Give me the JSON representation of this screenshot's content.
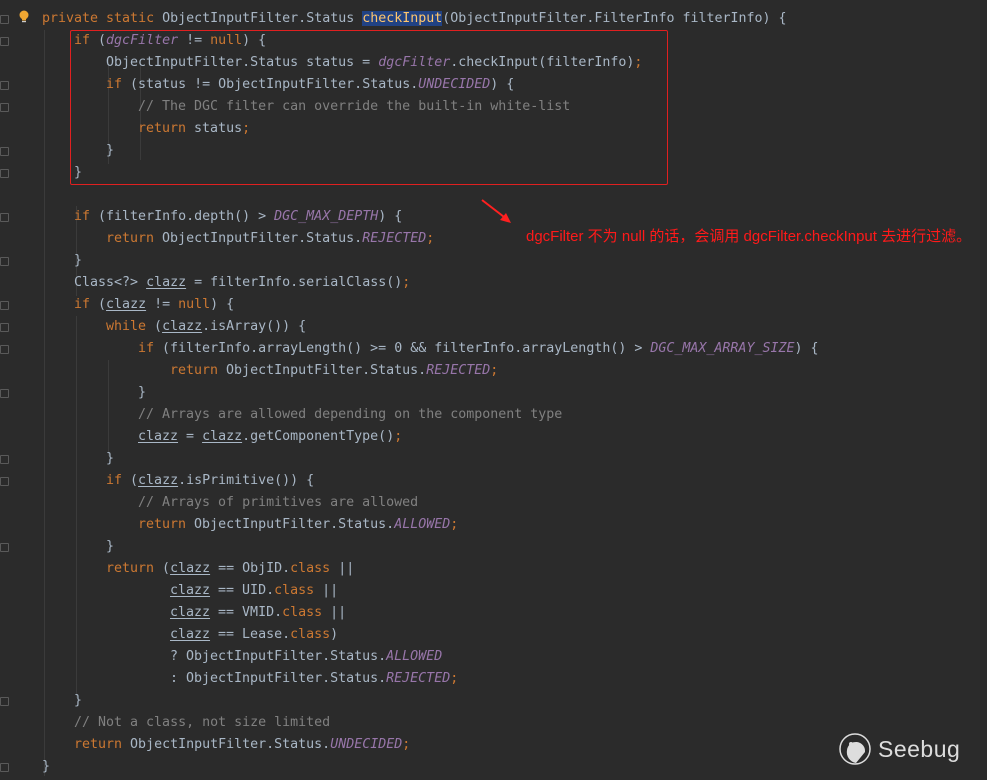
{
  "editor": {
    "lines": [
      [
        0,
        [
          [
            "kw",
            "private static "
          ],
          [
            "p",
            "ObjectInputFilter.Status "
          ],
          [
            "md",
            "checkInput"
          ],
          [
            "p",
            "(ObjectInputFilter.FilterInfo filterInfo) {"
          ]
        ]
      ],
      [
        1,
        [
          [
            "kw",
            "if "
          ],
          [
            "p",
            "("
          ],
          [
            "fld",
            "dgcFilter"
          ],
          [
            "p",
            " != "
          ],
          [
            "kw",
            "null"
          ],
          [
            "p",
            ") {"
          ]
        ]
      ],
      [
        2,
        [
          [
            "p",
            "ObjectInputFilter.Status status = "
          ],
          [
            "fld",
            "dgcFilter"
          ],
          [
            "p",
            ".checkInput(filterInfo)"
          ],
          [
            "kw",
            ";"
          ]
        ]
      ],
      [
        2,
        [
          [
            "kw",
            "if "
          ],
          [
            "p",
            "(status != ObjectInputFilter.Status."
          ],
          [
            "fld",
            "UNDECIDED"
          ],
          [
            "p",
            ") {"
          ]
        ]
      ],
      [
        3,
        [
          [
            "cm",
            "// The DGC filter can override the built-in white-list"
          ]
        ]
      ],
      [
        3,
        [
          [
            "kw",
            "return "
          ],
          [
            "p",
            "status"
          ],
          [
            "kw",
            ";"
          ]
        ]
      ],
      [
        2,
        [
          [
            "p",
            "}"
          ]
        ]
      ],
      [
        1,
        [
          [
            "p",
            "}"
          ]
        ]
      ],
      [
        0,
        []
      ],
      [
        1,
        [
          [
            "kw",
            "if "
          ],
          [
            "p",
            "(filterInfo.depth() > "
          ],
          [
            "fld",
            "DGC_MAX_DEPTH"
          ],
          [
            "p",
            ") {"
          ]
        ]
      ],
      [
        2,
        [
          [
            "kw",
            "return "
          ],
          [
            "p",
            "ObjectInputFilter.Status."
          ],
          [
            "fld",
            "REJECTED"
          ],
          [
            "kw",
            ";"
          ]
        ]
      ],
      [
        1,
        [
          [
            "p",
            "}"
          ]
        ]
      ],
      [
        1,
        [
          [
            "p",
            "Class<?> "
          ],
          [
            "ul",
            "clazz"
          ],
          [
            "p",
            " = filterInfo.serialClass()"
          ],
          [
            "kw",
            ";"
          ]
        ]
      ],
      [
        1,
        [
          [
            "kw",
            "if "
          ],
          [
            "p",
            "("
          ],
          [
            "ul",
            "clazz"
          ],
          [
            "p",
            " != "
          ],
          [
            "kw",
            "null"
          ],
          [
            "p",
            ") {"
          ]
        ]
      ],
      [
        2,
        [
          [
            "kw",
            "while "
          ],
          [
            "p",
            "("
          ],
          [
            "ul",
            "clazz"
          ],
          [
            "p",
            ".isArray()) {"
          ]
        ]
      ],
      [
        3,
        [
          [
            "kw",
            "if "
          ],
          [
            "p",
            "(filterInfo.arrayLength() >= 0 && filterInfo.arrayLength() > "
          ],
          [
            "fld",
            "DGC_MAX_ARRAY_SIZE"
          ],
          [
            "p",
            ") {"
          ]
        ]
      ],
      [
        4,
        [
          [
            "kw",
            "return "
          ],
          [
            "p",
            "ObjectInputFilter.Status."
          ],
          [
            "fld",
            "REJECTED"
          ],
          [
            "kw",
            ";"
          ]
        ]
      ],
      [
        3,
        [
          [
            "p",
            "}"
          ]
        ]
      ],
      [
        3,
        [
          [
            "cm",
            "// Arrays are allowed depending on the component type"
          ]
        ]
      ],
      [
        3,
        [
          [
            "ul",
            "clazz"
          ],
          [
            "p",
            " = "
          ],
          [
            "ul",
            "clazz"
          ],
          [
            "p",
            ".getComponentType()"
          ],
          [
            "kw",
            ";"
          ]
        ]
      ],
      [
        2,
        [
          [
            "p",
            "}"
          ]
        ]
      ],
      [
        2,
        [
          [
            "kw",
            "if "
          ],
          [
            "p",
            "("
          ],
          [
            "ul",
            "clazz"
          ],
          [
            "p",
            ".isPrimitive()) {"
          ]
        ]
      ],
      [
        3,
        [
          [
            "cm",
            "// Arrays of primitives are allowed"
          ]
        ]
      ],
      [
        3,
        [
          [
            "kw",
            "return "
          ],
          [
            "p",
            "ObjectInputFilter.Status."
          ],
          [
            "fld",
            "ALLOWED"
          ],
          [
            "kw",
            ";"
          ]
        ]
      ],
      [
        2,
        [
          [
            "p",
            "}"
          ]
        ]
      ],
      [
        2,
        [
          [
            "kw",
            "return "
          ],
          [
            "p",
            "("
          ],
          [
            "ul",
            "clazz"
          ],
          [
            "p",
            " == ObjID."
          ],
          [
            "kw",
            "class "
          ],
          [
            "p",
            "||"
          ]
        ]
      ],
      [
        4,
        [
          [
            "ul",
            "clazz"
          ],
          [
            "p",
            " == UID."
          ],
          [
            "kw",
            "class "
          ],
          [
            "p",
            "||"
          ]
        ]
      ],
      [
        4,
        [
          [
            "ul",
            "clazz"
          ],
          [
            "p",
            " == VMID."
          ],
          [
            "kw",
            "class "
          ],
          [
            "p",
            "||"
          ]
        ]
      ],
      [
        4,
        [
          [
            "ul",
            "clazz"
          ],
          [
            "p",
            " == Lease."
          ],
          [
            "kw",
            "class"
          ],
          [
            "p",
            ")"
          ]
        ]
      ],
      [
        4,
        [
          [
            "p",
            "? ObjectInputFilter.Status."
          ],
          [
            "fld",
            "ALLOWED"
          ]
        ]
      ],
      [
        4,
        [
          [
            "p",
            ": ObjectInputFilter.Status."
          ],
          [
            "fld",
            "REJECTED"
          ],
          [
            "kw",
            ";"
          ]
        ]
      ],
      [
        1,
        [
          [
            "p",
            "}"
          ]
        ]
      ],
      [
        1,
        [
          [
            "cm",
            "// Not a class, not size limited"
          ]
        ]
      ],
      [
        1,
        [
          [
            "kw",
            "return "
          ],
          [
            "p",
            "ObjectInputFilter.Status."
          ],
          [
            "fld",
            "UNDECIDED"
          ],
          [
            "kw",
            ";"
          ]
        ]
      ],
      [
        0,
        [
          [
            "p",
            "}"
          ]
        ]
      ]
    ],
    "fold_lines": [
      1,
      2,
      4,
      5,
      7,
      8,
      10,
      12,
      14,
      15,
      16,
      18,
      21,
      22,
      25,
      32,
      35
    ]
  },
  "annotation": {
    "text": "dgcFilter 不为 null 的话，会调用 dgcFilter.checkInput 去进行过滤。",
    "color": "#ff1a1a"
  },
  "watermark": {
    "text": "Seebug"
  },
  "icons": {
    "gutter": "lightbulb-icon",
    "arrow": "red-arrow-icon",
    "logo": "seebug-logo-icon"
  }
}
